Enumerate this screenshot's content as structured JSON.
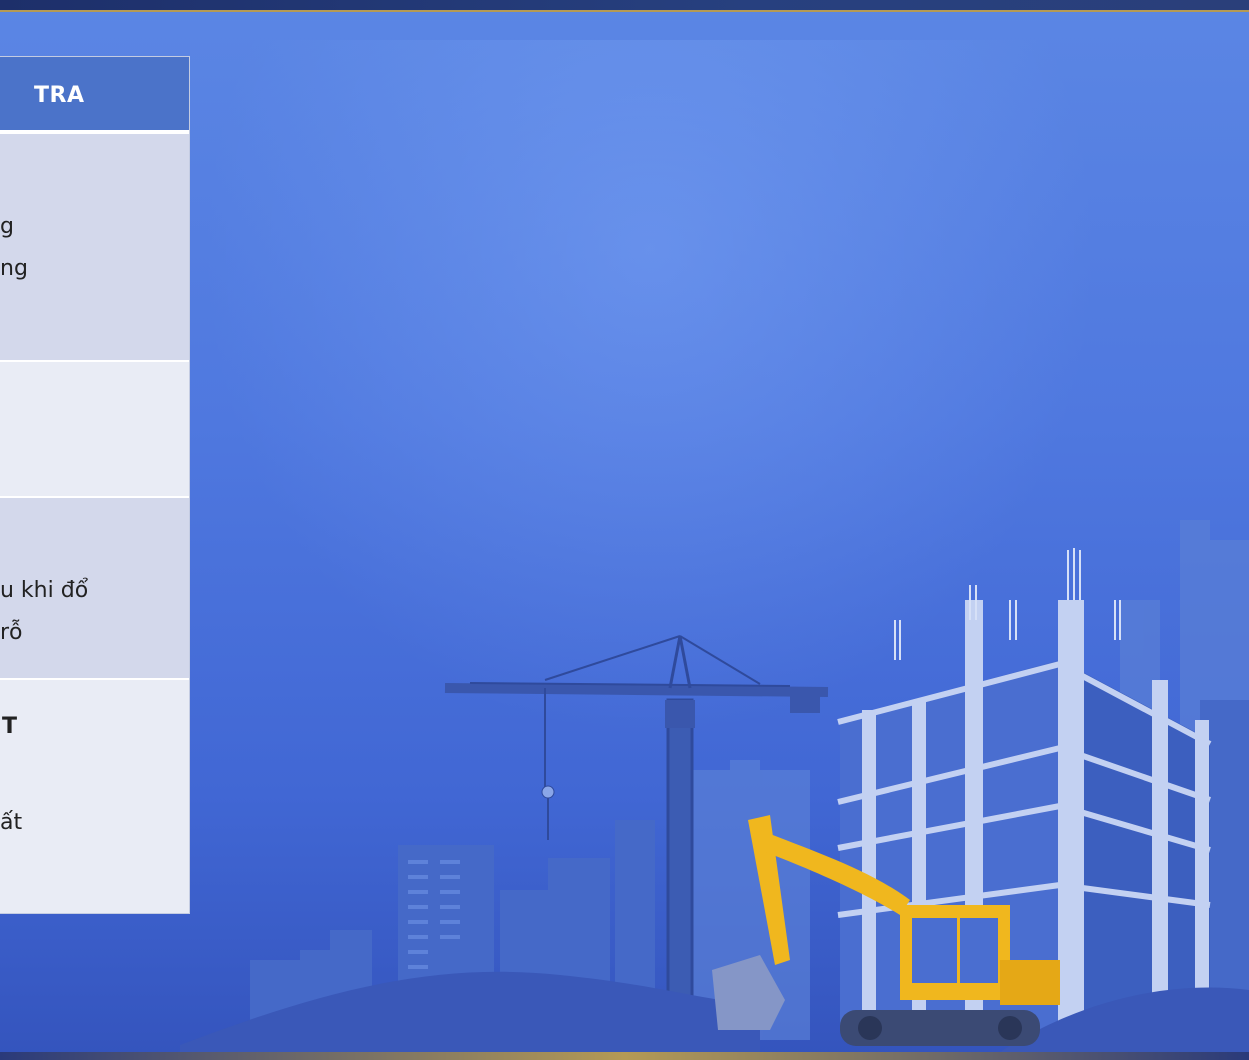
{
  "table": {
    "header_label": "TRA",
    "rows": [
      {
        "lines": [
          "g",
          "ng"
        ]
      },
      {
        "lines": []
      },
      {
        "lines": [
          "u khi đổ",
          "rỗ"
        ]
      },
      {
        "lines": [
          "T",
          "ất"
        ]
      }
    ]
  },
  "colors": {
    "header_bg": "#4b73c9",
    "row_alt": "#d3d8eb",
    "row_light": "#e9ecf5",
    "background": "#4f78df",
    "excavator": "#f0b71e"
  },
  "icons": [
    "tower-crane-icon",
    "excavator-icon",
    "building-under-construction-icon"
  ]
}
